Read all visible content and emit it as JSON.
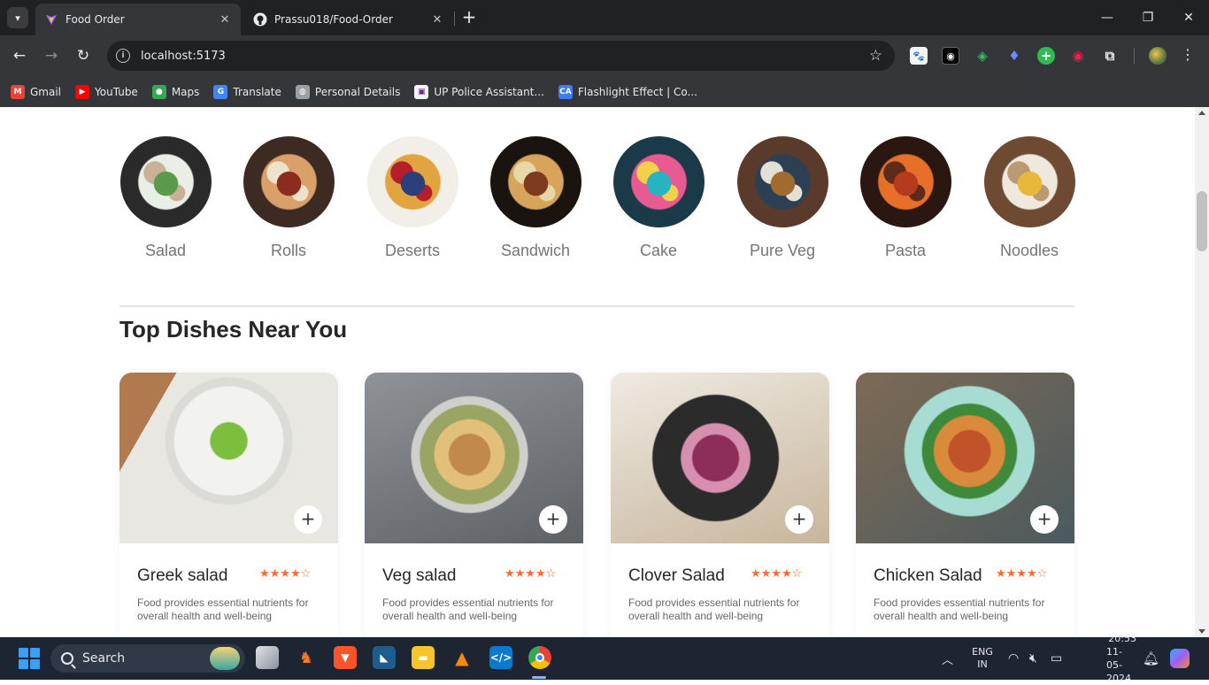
{
  "browser": {
    "tabs": [
      {
        "title": "Food Order",
        "active": true
      },
      {
        "title": "Prassu018/Food-Order",
        "active": false
      }
    ],
    "url": "localhost:5173",
    "bookmarks": [
      {
        "label": "Gmail",
        "icon": "gmail-icon",
        "color": "#ea4335",
        "glyph": "M"
      },
      {
        "label": "YouTube",
        "icon": "youtube-icon",
        "color": "#ff0000",
        "glyph": "▶"
      },
      {
        "label": "Maps",
        "icon": "maps-icon",
        "color": "#34a853",
        "glyph": "●"
      },
      {
        "label": "Translate",
        "icon": "translate-icon",
        "color": "#4285f4",
        "glyph": "G"
      },
      {
        "label": "Personal Details",
        "icon": "globe-icon",
        "color": "#9aa0a6",
        "glyph": "◍"
      },
      {
        "label": "UP Police Assistant...",
        "icon": "up-police-icon",
        "color": "#f1f3f4",
        "glyph": "▣"
      },
      {
        "label": "Flashlight Effect | Co...",
        "icon": "flashlight-effect-icon",
        "color": "#3d7bf7",
        "glyph": "CA"
      }
    ]
  },
  "page": {
    "categories": [
      {
        "label": "Salad",
        "colors": [
          "#2a2a2a",
          "#e9efe6",
          "#5c9a4b",
          "#c9b197"
        ]
      },
      {
        "label": "Rolls",
        "colors": [
          "#3d2a22",
          "#d9a06a",
          "#8b2c1f",
          "#efe2cc"
        ]
      },
      {
        "label": "Deserts",
        "colors": [
          "#f2efe8",
          "#e1a53f",
          "#2b3f7a",
          "#b51e2a"
        ]
      },
      {
        "label": "Sandwich",
        "colors": [
          "#1a1410",
          "#d8a35b",
          "#7e3a1e",
          "#e8d7a8"
        ]
      },
      {
        "label": "Cake",
        "colors": [
          "#1a3a4a",
          "#e85a92",
          "#27b4c0",
          "#f3d14c"
        ]
      },
      {
        "label": "Pure Veg",
        "colors": [
          "#5a3a2a",
          "#2d3f52",
          "#a16a2e",
          "#e3e0d8"
        ]
      },
      {
        "label": "Pasta",
        "colors": [
          "#2a1712",
          "#e6702a",
          "#b53b1c",
          "#5e2a1b"
        ]
      },
      {
        "label": "Noodles",
        "colors": [
          "#6e4a32",
          "#efe8dc",
          "#e7b93a",
          "#b99a73"
        ]
      }
    ],
    "section_title": "Top Dishes Near You",
    "dishes": [
      {
        "name": "Greek salad",
        "rating": 4,
        "description": "Food provides essential nutrients for overall health and well-being"
      },
      {
        "name": "Veg salad",
        "rating": 4,
        "description": "Food provides essential nutrients for overall health and well-being"
      },
      {
        "name": "Clover Salad",
        "rating": 4,
        "description": "Food provides essential nutrients for overall health and well-being"
      },
      {
        "name": "Chicken Salad",
        "rating": 4,
        "description": "Food provides essential nutrients for overall health and well-being"
      }
    ],
    "accent_color": "#ff6a2b"
  },
  "taskbar": {
    "search_label": "Search",
    "language_line1": "ENG",
    "language_line2": "IN",
    "time": "20:53",
    "date": "11-05-2024",
    "apps": [
      "task-view-icon",
      "app-icon",
      "brave-icon",
      "mysql-workbench-icon",
      "file-explorer-icon",
      "vlc-icon",
      "vscode-icon",
      "chrome-icon"
    ]
  }
}
